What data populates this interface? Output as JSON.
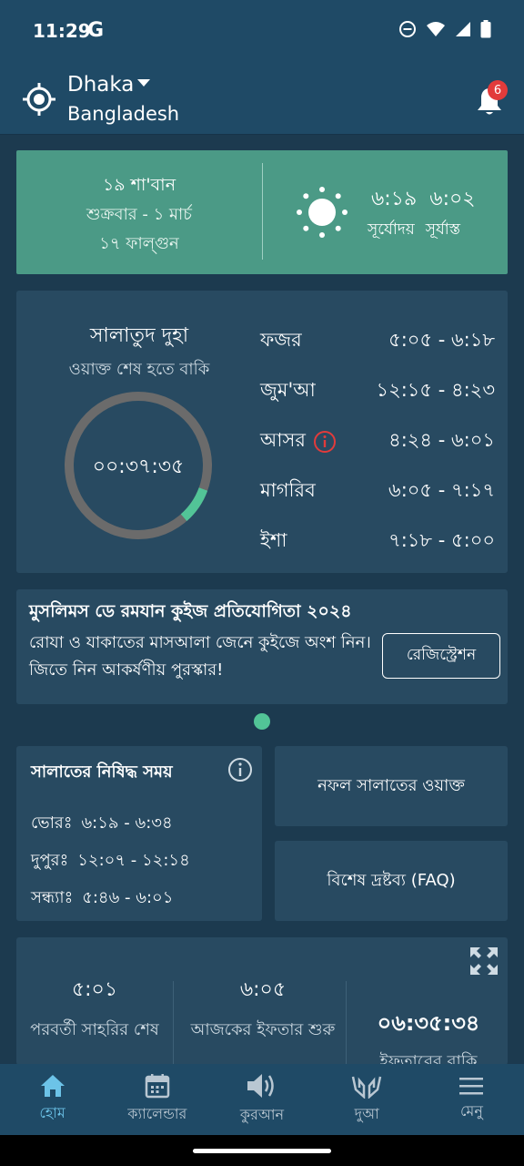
{
  "status_bar": {
    "time": "11:29",
    "google": "G"
  },
  "header": {
    "city": "Dhaka",
    "country": "Bangladesh",
    "notification_count": "6"
  },
  "date_card": {
    "hijri": "১৯ শা'বান",
    "weekday_gregorian": "শুক্রবার - ১ মার্চ",
    "bangla_date": "১৭ ফাল্গুন",
    "sunrise_time": "৬:১৯",
    "sunset_time": "৬:০২",
    "sunrise_label": "সূর্যোদয়",
    "sunset_label": "সূর্যাস্ত"
  },
  "prayer_card": {
    "current_name": "সালাতুদ দুহা",
    "remaining_label": "ওয়াক্ত শেষ হতে বাকি",
    "countdown": "০০:৩৭:৩৫",
    "progress_fraction": 0.08,
    "prayers": [
      {
        "name": "ফজর",
        "time": "৫:০৫ - ৬:১৮"
      },
      {
        "name": "জুম'আ",
        "time": "১২:১৫ - ৪:২৩"
      },
      {
        "name": "আসর",
        "time": "৪:২৪ - ৬:০১"
      },
      {
        "name": "মাগরিব",
        "time": "৬:০৫ - ৭:১৭"
      },
      {
        "name": "ইশা",
        "time": "৭:১৮ - ৫:০০"
      }
    ]
  },
  "quiz_banner": {
    "title": "মুসলিমস ডে রমযান কুইজ প্রতিযোগিতা ২০২৪",
    "text": "রোযা ও যাকাতের মাসআলা জেনে কুইজে অংশ নিন। জিতে নিন আকর্ষণীয় পুরস্কার!",
    "button": "রেজিস্ট্রেশন"
  },
  "forbidden_card": {
    "title": "সালাতের নিষিদ্ধ সময়",
    "rows": [
      {
        "label": "ভোরঃ",
        "time": "৬:১৯ - ৬:৩৪"
      },
      {
        "label": "দুপুরঃ",
        "time": "১২:০৭ - ১২:১৪"
      },
      {
        "label": "সন্ধ্যাঃ",
        "time": "৫:৪৬ - ৬:০১"
      }
    ]
  },
  "nafl_button": "নফল সালাতের ওয়াক্ত",
  "faq_button": "বিশেষ দ্রষ্টব্য (FAQ)",
  "iftar_card": {
    "sehri_time": "৫:০১",
    "sehri_label": "পরবর্তী সাহরির শেষ",
    "iftar_time": "৬:০৫",
    "iftar_label": "আজকের ইফতার শুরু",
    "countdown": "০৬:৩৫:৩৪",
    "countdown_label": "ইফতারের বাকি"
  },
  "bottom_nav": [
    {
      "label": "হোম",
      "icon": "home-icon"
    },
    {
      "label": "ক্যালেন্ডার",
      "icon": "calendar-icon"
    },
    {
      "label": "কুরআন",
      "icon": "speaker-icon"
    },
    {
      "label": "দুআ",
      "icon": "dua-hands-icon"
    },
    {
      "label": "মেনু",
      "icon": "menu-icon"
    }
  ],
  "colors": {
    "accent": "#4b9a86",
    "progress": "#52c497",
    "background": "#1c3a4f",
    "card": "#284a61",
    "alert": "#e23b3b"
  }
}
